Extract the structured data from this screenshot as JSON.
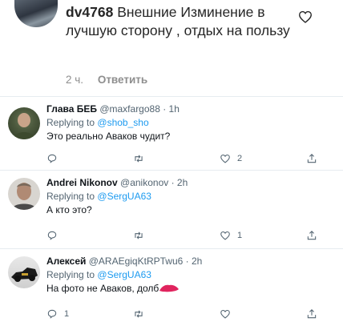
{
  "ig_comment": {
    "username": "dv4768",
    "text": "Внешние Изминение в лучшую сторону , отдых на пользу",
    "time": "2 ч.",
    "reply_label": "Ответить"
  },
  "tweets": [
    {
      "name": "Глава БЕБ",
      "handle": "@maxfargo88 · 1h",
      "replying_prefix": "Replying to",
      "replying_to": "@shob_sho",
      "text": "Это реально Аваков чудит?",
      "like_count": "2",
      "retweet_count": "",
      "reply_count": ""
    },
    {
      "name": "Andrei Nikonov",
      "handle": "@anikonov · 2h",
      "replying_prefix": "Replying to",
      "replying_to": "@SergUA63",
      "text": "А кто это?",
      "like_count": "1",
      "retweet_count": "",
      "reply_count": ""
    },
    {
      "name": "Алексей",
      "handle": "@ARAEgiqKtRPTwu6 · 2h",
      "replying_prefix": "Replying to",
      "replying_to": "@SergUA63",
      "text": "На фото не Аваков, долб",
      "like_count": "",
      "retweet_count": "",
      "reply_count": "1"
    }
  ],
  "icons": [
    "heart-icon",
    "reply-icon",
    "retweet-icon",
    "like-icon",
    "share-icon"
  ],
  "colors": {
    "link": "#1d9bf0",
    "secondary": "#536471",
    "censor": "#e0245e"
  }
}
